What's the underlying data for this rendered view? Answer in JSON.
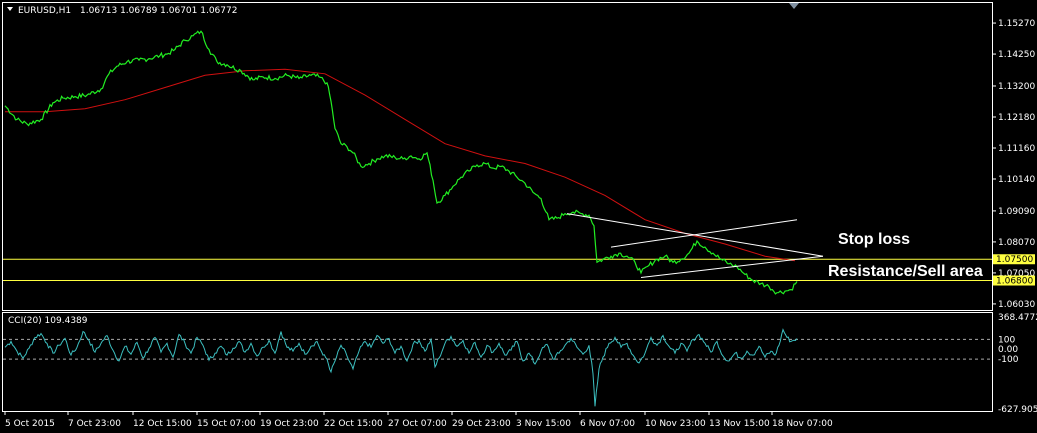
{
  "header": {
    "symbol": "EURUSD,H1",
    "ohlc": "1.06713 1.06789 1.06701 1.06772"
  },
  "cci_header": "CCI(20) 109.4389",
  "annotations": {
    "stop_loss": "Stop loss",
    "resistance": "Resistance/Sell area"
  },
  "colors": {
    "background": "#000000",
    "price": "#22ee22",
    "ma": "#d01010",
    "cci": "#3cbfc0",
    "level": "#ffff40",
    "trendline": "#ffffff",
    "frame": "#ffffff"
  },
  "chart_data": [
    {
      "type": "line",
      "title": "EURUSD,H1",
      "xlabel": "",
      "ylabel": "",
      "ylim": [
        1.0583,
        1.1593
      ],
      "y_ticks": [
        "1.15270",
        "1.14250",
        "1.13200",
        "1.12180",
        "1.11160",
        "1.10140",
        "1.09090",
        "1.08070",
        "1.07050",
        "1.06030"
      ],
      "x_ticks": [
        "5 Oct 2015",
        "7 Oct 23:00",
        "12 Oct 15:00",
        "15 Oct 07:00",
        "19 Oct 23:00",
        "22 Oct 15:00",
        "27 Oct 07:00",
        "29 Oct 23:00",
        "3 Nov 15:00",
        "6 Nov 07:00",
        "10 Nov 23:00",
        "13 Nov 15:00",
        "18 Nov 07:00"
      ],
      "horizontal_levels": [
        {
          "label": "1.07500",
          "value": 1.075
        },
        {
          "label": "1.06800",
          "value": 1.068
        }
      ],
      "series": [
        {
          "values": [
            [
              0,
              1.1255
            ],
            [
              12,
              1.121
            ],
            [
              22,
              1.1195
            ],
            [
              36,
              1.121
            ],
            [
              48,
              1.1265
            ],
            [
              58,
              1.128
            ],
            [
              70,
              1.1285
            ],
            [
              82,
              1.129
            ],
            [
              96,
              1.131
            ],
            [
              104,
              1.136
            ],
            [
              112,
              1.1385
            ],
            [
              122,
              1.14
            ],
            [
              134,
              1.1405
            ],
            [
              144,
              1.141
            ],
            [
              155,
              1.142
            ],
            [
              162,
              1.1425
            ],
            [
              170,
              1.144
            ],
            [
              180,
              1.147
            ],
            [
              188,
              1.1485
            ],
            [
              196,
              1.15
            ],
            [
              204,
              1.144
            ],
            [
              212,
              1.14
            ],
            [
              222,
              1.139
            ],
            [
              236,
              1.137
            ],
            [
              248,
              1.134
            ],
            [
              258,
              1.135
            ],
            [
              270,
              1.1345
            ],
            [
              282,
              1.1355
            ],
            [
              294,
              1.1345
            ],
            [
              306,
              1.1355
            ],
            [
              314,
              1.135
            ],
            [
              322,
              1.133
            ],
            [
              326,
              1.127
            ],
            [
              330,
              1.118
            ],
            [
              336,
              1.113
            ],
            [
              342,
              1.112
            ],
            [
              348,
              1.11
            ],
            [
              356,
              1.1055
            ],
            [
              364,
              1.1065
            ],
            [
              372,
              1.108
            ],
            [
              380,
              1.109
            ],
            [
              390,
              1.1085
            ],
            [
              398,
              1.108
            ],
            [
              406,
              1.109
            ],
            [
              414,
              1.108
            ],
            [
              422,
              1.11
            ],
            [
              428,
              1.101
            ],
            [
              432,
              1.0935
            ],
            [
              440,
              1.096
            ],
            [
              448,
              1.099
            ],
            [
              456,
              1.102
            ],
            [
              464,
              1.104
            ],
            [
              472,
              1.106
            ],
            [
              480,
              1.1065
            ],
            [
              488,
              1.105
            ],
            [
              496,
              1.1055
            ],
            [
              504,
              1.104
            ],
            [
              512,
              1.102
            ],
            [
              520,
              1.1
            ],
            [
              528,
              1.097
            ],
            [
              536,
              1.095
            ],
            [
              544,
              1.088
            ],
            [
              552,
              1.0885
            ],
            [
              560,
              1.09
            ],
            [
              568,
              1.0905
            ],
            [
              576,
              1.09
            ],
            [
              584,
              1.0895
            ],
            [
              589,
              1.086
            ],
            [
              592,
              1.074
            ],
            [
              598,
              1.075
            ],
            [
              606,
              1.076
            ],
            [
              614,
              1.077
            ],
            [
              622,
              1.076
            ],
            [
              630,
              1.074
            ],
            [
              636,
              1.0705
            ],
            [
              644,
              1.073
            ],
            [
              652,
              1.075
            ],
            [
              660,
              1.076
            ],
            [
              668,
              1.074
            ],
            [
              676,
              1.075
            ],
            [
              684,
              1.077
            ],
            [
              692,
              1.081
            ],
            [
              700,
              1.079
            ],
            [
              708,
              1.077
            ],
            [
              716,
              1.075
            ],
            [
              724,
              1.0735
            ],
            [
              732,
              1.0725
            ],
            [
              740,
              1.07
            ],
            [
              748,
              1.068
            ],
            [
              756,
              1.067
            ],
            [
              764,
              1.066
            ],
            [
              772,
              1.064
            ],
            [
              780,
              1.0645
            ],
            [
              786,
              1.065
            ],
            [
              792,
              1.0677
            ]
          ]
        },
        {
          "values": [
            [
              0,
              1.1235
            ],
            [
              40,
              1.1235
            ],
            [
              80,
              1.1245
            ],
            [
              120,
              1.1275
            ],
            [
              160,
              1.1315
            ],
            [
              200,
              1.1355
            ],
            [
              240,
              1.137
            ],
            [
              280,
              1.1375
            ],
            [
              320,
              1.136
            ],
            [
              360,
              1.129
            ],
            [
              400,
              1.121
            ],
            [
              440,
              1.113
            ],
            [
              480,
              1.109
            ],
            [
              520,
              1.1065
            ],
            [
              560,
              1.102
            ],
            [
              600,
              1.096
            ],
            [
              640,
              1.088
            ],
            [
              680,
              1.0835
            ],
            [
              720,
              1.08
            ],
            [
              760,
              1.076
            ],
            [
              790,
              1.0745
            ]
          ]
        }
      ],
      "trendlines": [
        {
          "from": [
            562,
            1.09
          ],
          "to": [
            818,
            1.076
          ]
        },
        {
          "from": [
            606,
            1.079
          ],
          "to": [
            792,
            1.088
          ]
        },
        {
          "from": [
            636,
            1.069
          ],
          "to": [
            818,
            1.076
          ]
        }
      ]
    },
    {
      "type": "line",
      "title": "CCI(20) 109.4389",
      "xlabel": "",
      "ylabel": "",
      "ylim": [
        -627.9053,
        368.4772
      ],
      "y_ticks": [
        "368.4772",
        "100",
        "0.00",
        "-100",
        "-627.9053"
      ],
      "series": [
        {
          "values": [
            [
              0,
              20
            ],
            [
              6,
              80
            ],
            [
              12,
              -20
            ],
            [
              18,
              -90
            ],
            [
              24,
              10
            ],
            [
              30,
              120
            ],
            [
              36,
              160
            ],
            [
              42,
              60
            ],
            [
              48,
              -40
            ],
            [
              54,
              40
            ],
            [
              60,
              110
            ],
            [
              66,
              -60
            ],
            [
              72,
              20
            ],
            [
              78,
              180
            ],
            [
              84,
              90
            ],
            [
              90,
              -30
            ],
            [
              96,
              60
            ],
            [
              102,
              140
            ],
            [
              108,
              -10
            ],
            [
              114,
              -120
            ],
            [
              120,
              30
            ],
            [
              126,
              -50
            ],
            [
              132,
              70
            ],
            [
              138,
              -90
            ],
            [
              144,
              10
            ],
            [
              150,
              120
            ],
            [
              156,
              -30
            ],
            [
              162,
              60
            ],
            [
              168,
              -80
            ],
            [
              174,
              150
            ],
            [
              180,
              60
            ],
            [
              186,
              -40
            ],
            [
              192,
              120
            ],
            [
              198,
              40
            ],
            [
              204,
              -110
            ],
            [
              210,
              -40
            ],
            [
              216,
              30
            ],
            [
              222,
              -60
            ],
            [
              228,
              10
            ],
            [
              234,
              80
            ],
            [
              240,
              -30
            ],
            [
              246,
              60
            ],
            [
              252,
              -70
            ],
            [
              258,
              20
            ],
            [
              264,
              90
            ],
            [
              270,
              -40
            ],
            [
              276,
              180
            ],
            [
              282,
              20
            ],
            [
              288,
              -20
            ],
            [
              294,
              60
            ],
            [
              300,
              -50
            ],
            [
              306,
              30
            ],
            [
              312,
              80
            ],
            [
              318,
              -60
            ],
            [
              322,
              -100
            ],
            [
              326,
              -230
            ],
            [
              330,
              -120
            ],
            [
              336,
              40
            ],
            [
              342,
              -70
            ],
            [
              348,
              -200
            ],
            [
              354,
              -20
            ],
            [
              360,
              80
            ],
            [
              366,
              20
            ],
            [
              372,
              140
            ],
            [
              378,
              60
            ],
            [
              384,
              110
            ],
            [
              390,
              -40
            ],
            [
              396,
              30
            ],
            [
              402,
              -120
            ],
            [
              408,
              50
            ],
            [
              414,
              90
            ],
            [
              420,
              -20
            ],
            [
              426,
              100
            ],
            [
              430,
              -180
            ],
            [
              434,
              -90
            ],
            [
              440,
              60
            ],
            [
              446,
              130
            ],
            [
              452,
              30
            ],
            [
              458,
              90
            ],
            [
              464,
              -40
            ],
            [
              470,
              70
            ],
            [
              476,
              -80
            ],
            [
              482,
              40
            ],
            [
              488,
              -30
            ],
            [
              494,
              60
            ],
            [
              500,
              -60
            ],
            [
              506,
              -10
            ],
            [
              512,
              80
            ],
            [
              518,
              -120
            ],
            [
              524,
              -40
            ],
            [
              530,
              -150
            ],
            [
              536,
              -20
            ],
            [
              542,
              50
            ],
            [
              548,
              -100
            ],
            [
              554,
              -40
            ],
            [
              560,
              40
            ],
            [
              566,
              110
            ],
            [
              572,
              20
            ],
            [
              578,
              -50
            ],
            [
              584,
              40
            ],
            [
              588,
              -250
            ],
            [
              590,
              -580
            ],
            [
              594,
              -200
            ],
            [
              598,
              -80
            ],
            [
              604,
              60
            ],
            [
              610,
              120
            ],
            [
              616,
              20
            ],
            [
              622,
              60
            ],
            [
              628,
              -60
            ],
            [
              634,
              -140
            ],
            [
              640,
              -40
            ],
            [
              646,
              120
            ],
            [
              652,
              40
            ],
            [
              658,
              140
            ],
            [
              664,
              30
            ],
            [
              670,
              -40
            ],
            [
              676,
              60
            ],
            [
              682,
              -20
            ],
            [
              688,
              100
            ],
            [
              694,
              150
            ],
            [
              700,
              60
            ],
            [
              706,
              -30
            ],
            [
              712,
              80
            ],
            [
              718,
              -70
            ],
            [
              724,
              -120
            ],
            [
              730,
              -40
            ],
            [
              736,
              -90
            ],
            [
              742,
              -20
            ],
            [
              748,
              -60
            ],
            [
              754,
              30
            ],
            [
              760,
              -80
            ],
            [
              766,
              -20
            ],
            [
              770,
              -60
            ],
            [
              774,
              40
            ],
            [
              778,
              200
            ],
            [
              782,
              120
            ],
            [
              786,
              80
            ],
            [
              792,
              109
            ]
          ]
        }
      ],
      "horizontal_levels": [
        {
          "label": "100",
          "value": 100
        },
        {
          "label": "-100",
          "value": -100
        }
      ]
    }
  ]
}
